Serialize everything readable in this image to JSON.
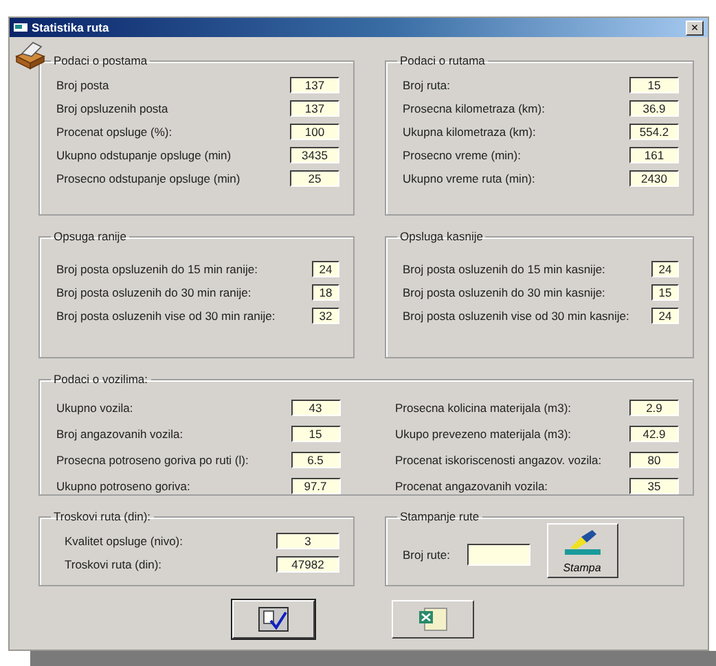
{
  "window": {
    "title": "Statistika ruta",
    "close": "×"
  },
  "groups": [
    {
      "title": "Podaci o postama",
      "rows": [
        {
          "label": "Broj posta",
          "value": "137"
        },
        {
          "label": "Broj opsluzenih posta",
          "value": "137"
        },
        {
          "label": "Procenat opsluge (%):",
          "value": "100"
        },
        {
          "label": "Ukupno odstupanje opsluge (min)",
          "value": "3435"
        },
        {
          "label": "Prosecno odstupanje opsluge (min)",
          "value": "25"
        }
      ]
    },
    {
      "title": "Podaci o rutama",
      "rows": [
        {
          "label": "Broj ruta:",
          "value": "15"
        },
        {
          "label": "Prosecna kilometraza (km):",
          "value": "36.9"
        },
        {
          "label": "Ukupna kilometraza (km):",
          "value": "554.2"
        },
        {
          "label": "Prosecno vreme (min):",
          "value": "161"
        },
        {
          "label": "Ukupno vreme ruta (min):",
          "value": "2430"
        }
      ]
    },
    {
      "title": "Opsuga ranije",
      "rows": [
        {
          "label": "Broj posta opsluzenih do 15 min ranije:",
          "value": "24"
        },
        {
          "label": "Broj posta osluzenih do 30 min ranije:",
          "value": "18"
        },
        {
          "label": "Broj posta osluzenih vise od 30 min ranije:",
          "value": "32"
        }
      ]
    },
    {
      "title": "Opsluga kasnije",
      "rows": [
        {
          "label": "Broj posta osluzenih do 15 min kasnije:",
          "value": "24"
        },
        {
          "label": "Broj posta osluzenih do 30 min kasnije:",
          "value": "15"
        },
        {
          "label": "Broj posta osluzenih  vise od 30 min kasnije:",
          "value": "24"
        }
      ]
    }
  ],
  "vehicles": {
    "title": "Podaci o vozilima:",
    "columns": [
      [
        {
          "label": "Ukupno vozila:",
          "value": "43"
        },
        {
          "label": "Broj angazovanih vozila:",
          "value": "15"
        },
        {
          "label": "Prosecna potroseno goriva po ruti (l):",
          "value": "6.5"
        },
        {
          "label": "Ukupno potroseno goriva:",
          "value": "97.7"
        }
      ],
      [
        {
          "label": "Prosecna kolicina materijala (m3):",
          "value": "2.9"
        },
        {
          "label": "Ukupo prevezeno materijala (m3):",
          "value": "42.9"
        },
        {
          "label": "Procenat iskoriscenosti angazov. vozila:",
          "value": "80"
        },
        {
          "label": "Procenat angazovanih vozila:",
          "value": "35"
        }
      ]
    ]
  },
  "costs": {
    "title": "Troskovi ruta (din):",
    "rows": [
      {
        "label": "Kvalitet opsluge (nivo):",
        "value": "3"
      },
      {
        "label": "Troskovi ruta (din):",
        "value": "47982"
      }
    ]
  },
  "print": {
    "title": "Stampanje rute",
    "field_label": "Broj rute:",
    "button": "Stampa"
  }
}
